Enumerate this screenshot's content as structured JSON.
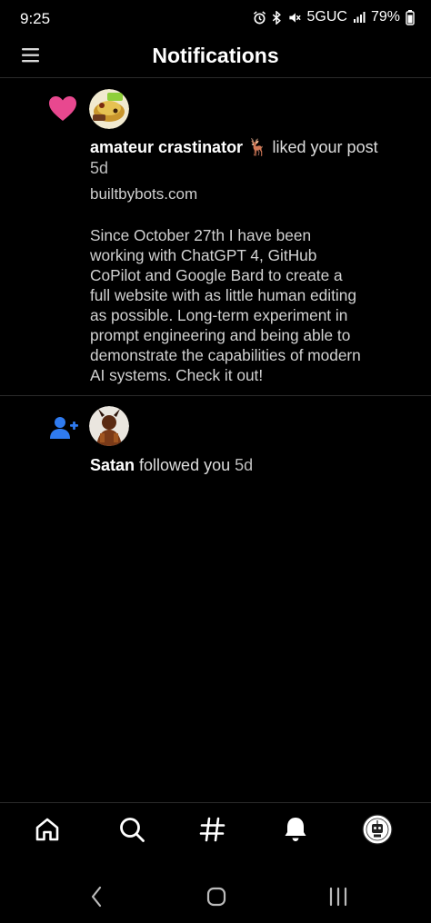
{
  "status_bar": {
    "time": "9:25",
    "network": "5GUC",
    "battery": "79%"
  },
  "header": {
    "title": "Notifications",
    "menu_icon": "hamburger-menu-icon"
  },
  "notifications": [
    {
      "type_icon": "heart-icon",
      "type_color": "#e8488f",
      "user": "amateur crastinator",
      "emoji": "🦌",
      "action": " liked your post",
      "time": "5d",
      "post_link": "builtbybots.com",
      "post_lines": [
        "Since October 27th I have been",
        "working with ChatGPT 4, GitHub",
        "CoPilot and Google Bard to create a",
        "full website with as little human editing",
        "as possible. Long-term experiment in",
        "prompt engineering and being able to",
        "demonstrate the capabilities of modern",
        "AI systems. Check it out!"
      ]
    },
    {
      "type_icon": "user-plus-icon",
      "type_color": "#2f7bf0",
      "user": "Satan",
      "action": " followed you ",
      "time": "5d"
    }
  ],
  "bottom_nav": [
    "home-icon",
    "search-icon",
    "hashtag-icon",
    "notifications-bell-icon",
    "profile-avatar"
  ],
  "system_nav": [
    "back-icon",
    "home-circle-icon",
    "recents-icon"
  ]
}
